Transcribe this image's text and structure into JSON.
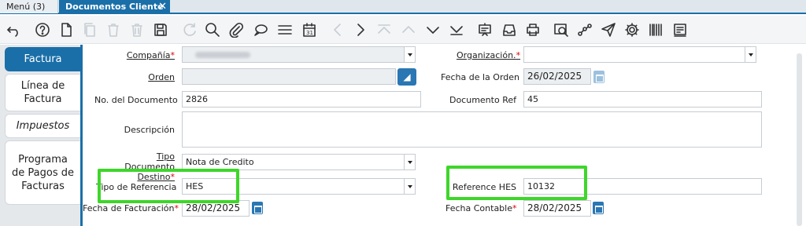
{
  "tabs": {
    "menu_label": "Menú (3)",
    "active_label": "Documentos Cliente",
    "close_glyph": "✕"
  },
  "toolbar": {
    "icons": [
      "undo-icon",
      "help-icon",
      "new-icon",
      "copy-icon",
      "delete-icon",
      "delete-selected-icon",
      "save-icon",
      "refresh-icon",
      "find-icon",
      "attachment-icon",
      "chat-icon",
      "grid-toggle-icon",
      "calendar-icon",
      "previous-page-icon",
      "next-page-icon",
      "first-record-icon",
      "previous-record-icon",
      "next-record-icon",
      "last-record-icon",
      "report-icon",
      "archive-icon",
      "print-icon",
      "zoom-across-icon",
      "workflow-icon",
      "send-icon",
      "process-icon",
      "barcode-icon",
      "form-icon"
    ]
  },
  "side_tabs": [
    {
      "label": "Factura",
      "active": true
    },
    {
      "label": "Línea de Factura",
      "active": false
    },
    {
      "label": "Impuestos",
      "active": false
    },
    {
      "label": "Programa de Pagos de Facturas",
      "active": false
    }
  ],
  "form": {
    "compania": {
      "label": "Compañía",
      "required": "*"
    },
    "organizacion": {
      "label": "Organización.",
      "required": "*",
      "value": ""
    },
    "orden": {
      "label": "Orden",
      "value": ""
    },
    "fecha_orden": {
      "label": "Fecha de la Orden",
      "value": "26/02/2025"
    },
    "no_documento": {
      "label": "No. del Documento",
      "value": "2826"
    },
    "documento_ref": {
      "label": "Documento Ref",
      "value": "45"
    },
    "descripcion": {
      "label": "Descripción",
      "value": ""
    },
    "tipo_documento_destino": {
      "label": "Tipo Documento Destino",
      "required": "*",
      "value": "Nota de Credito"
    },
    "tipo_referencia": {
      "label": "Tipo de Referencia",
      "value": "HES"
    },
    "reference_hes": {
      "label": "Reference HES",
      "value": "10132"
    },
    "fecha_facturacion": {
      "label": "Fecha de Facturación",
      "required": "*",
      "value": "28/02/2025"
    },
    "fecha_contable": {
      "label": "Fecha Contable",
      "required": "*",
      "value": "28/02/2025"
    }
  },
  "colors": {
    "accent": "#1a6fa8",
    "highlight": "#3ed62a",
    "required": "#d00000"
  }
}
